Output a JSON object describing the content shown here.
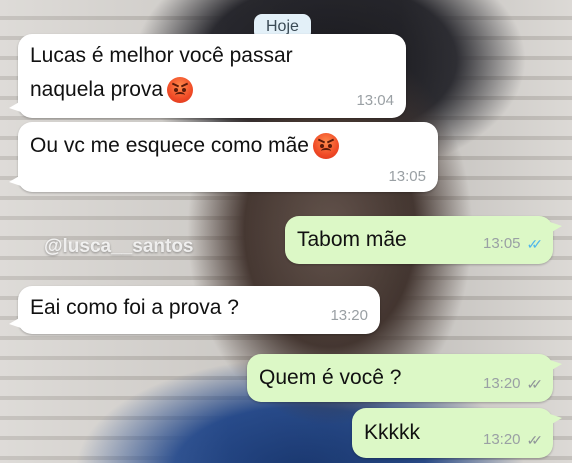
{
  "date_separator": "Hoje",
  "watermark": "@lusca__santos",
  "messages": [
    {
      "direction": "incoming",
      "line1": "Lucas é melhor você passar",
      "line2": "naquela prova",
      "emoji": "angry-face-icon",
      "time": "13:04"
    },
    {
      "direction": "incoming",
      "line1": "Ou vc me esquece como mãe",
      "emoji": "angry-face-icon",
      "time": "13:05"
    },
    {
      "direction": "outgoing",
      "text": "Tabom mãe",
      "time": "13:05",
      "status": "read"
    },
    {
      "direction": "incoming",
      "text": "Eai como foi a prova ?",
      "time": "13:20"
    },
    {
      "direction": "outgoing",
      "text": "Quem é você ?",
      "time": "13:20",
      "status": "delivered"
    },
    {
      "direction": "outgoing",
      "text": "Kkkkk",
      "time": "13:20",
      "status": "delivered"
    }
  ],
  "colors": {
    "incoming_bubble": "#ffffff",
    "outgoing_bubble": "#dcf8c6",
    "read_ticks": "#4fb6ec",
    "delivered_ticks": "#8f9599",
    "date_pill": "#e3f0f8"
  }
}
